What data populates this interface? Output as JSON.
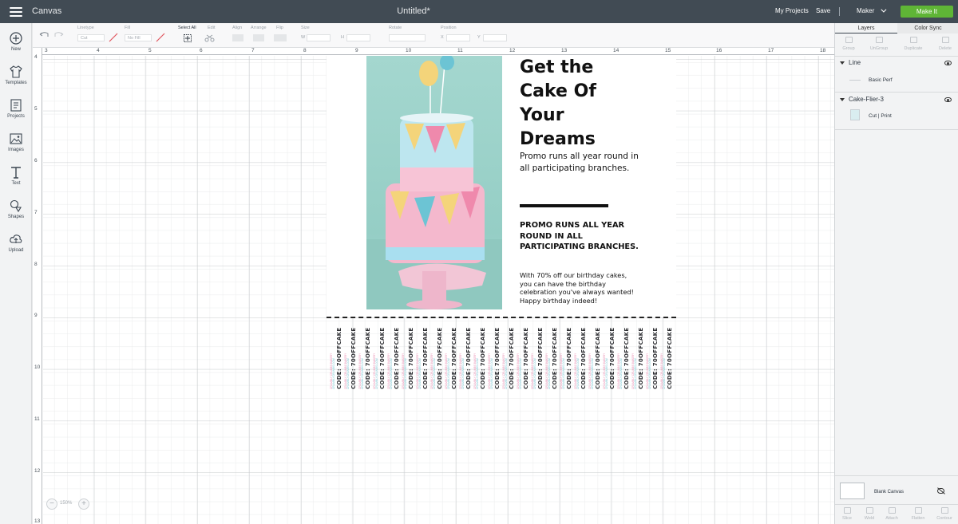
{
  "topbar": {
    "app_title": "Canvas",
    "doc_title": "Untitled*",
    "my_projects": "My Projects",
    "save": "Save",
    "machine": "Maker",
    "make_it": "Make It"
  },
  "left_tools": [
    {
      "label": "New",
      "icon": "plus-circle-icon"
    },
    {
      "label": "Templates",
      "icon": "tshirt-icon"
    },
    {
      "label": "Projects",
      "icon": "projects-icon"
    },
    {
      "label": "Images",
      "icon": "image-icon"
    },
    {
      "label": "Text",
      "icon": "text-t-icon"
    },
    {
      "label": "Shapes",
      "icon": "shapes-icon"
    },
    {
      "label": "Upload",
      "icon": "cloud-upload-icon"
    }
  ],
  "edit_toolbar": {
    "linetype_label": "Linetype",
    "linetype_value": "Cut",
    "fill_label": "Fill",
    "fill_value": "No Fill",
    "select_all": "Select All",
    "edit": "Edit",
    "align": "Align",
    "arrange": "Arrange",
    "flip": "Flip",
    "size": "Size",
    "w": "W",
    "h": "H",
    "rotate": "Rotate",
    "position": "Position",
    "x": "X",
    "y": "Y"
  },
  "rulers": {
    "horizontal": [
      "3",
      "4",
      "5",
      "6",
      "7",
      "8",
      "9",
      "10",
      "11",
      "12",
      "13",
      "14",
      "15",
      "16",
      "17",
      "18"
    ],
    "vertical": [
      "4",
      "5",
      "6",
      "7",
      "8",
      "9",
      "10",
      "11",
      "12",
      "13"
    ]
  },
  "flyer": {
    "headline": [
      "Get the",
      "Cake Of",
      "Your",
      "Dreams"
    ],
    "promo_small": "Promo runs all year round in all participating branches.",
    "promo_caps": "PROMO RUNS ALL YEAR ROUND IN ALL PARTICIPATING BRANCHES.",
    "promo_body": "With 70% off our birthday cakes, you can have the birthday celebration you've always wanted! Happy birthday indeed!",
    "tab_code": "CODE: 70OFFCAKE",
    "tab_brand": "CRUMBLY CRUMBS BAKERY",
    "tab_site": "CRUMBLYCRUMBS.COM",
    "tab_count": 24
  },
  "zoom": {
    "value": "150%"
  },
  "right_panel": {
    "tabs": [
      "Layers",
      "Color Sync"
    ],
    "actions": [
      "Group",
      "UnGroup",
      "Duplicate",
      "Delete"
    ],
    "layers": [
      {
        "name": "Line",
        "sub": "Basic Perf"
      },
      {
        "name": "Cake-Flier-3",
        "sub": "Cut  |  Print"
      }
    ],
    "blank_canvas": "Blank Canvas",
    "bottom_actions": [
      "Slice",
      "Weld",
      "Attach",
      "Flatten",
      "Contour"
    ]
  },
  "colors": {
    "topbar": "#414b54",
    "make_it": "#5fb536",
    "cake_bg": "#a4d7cf"
  }
}
